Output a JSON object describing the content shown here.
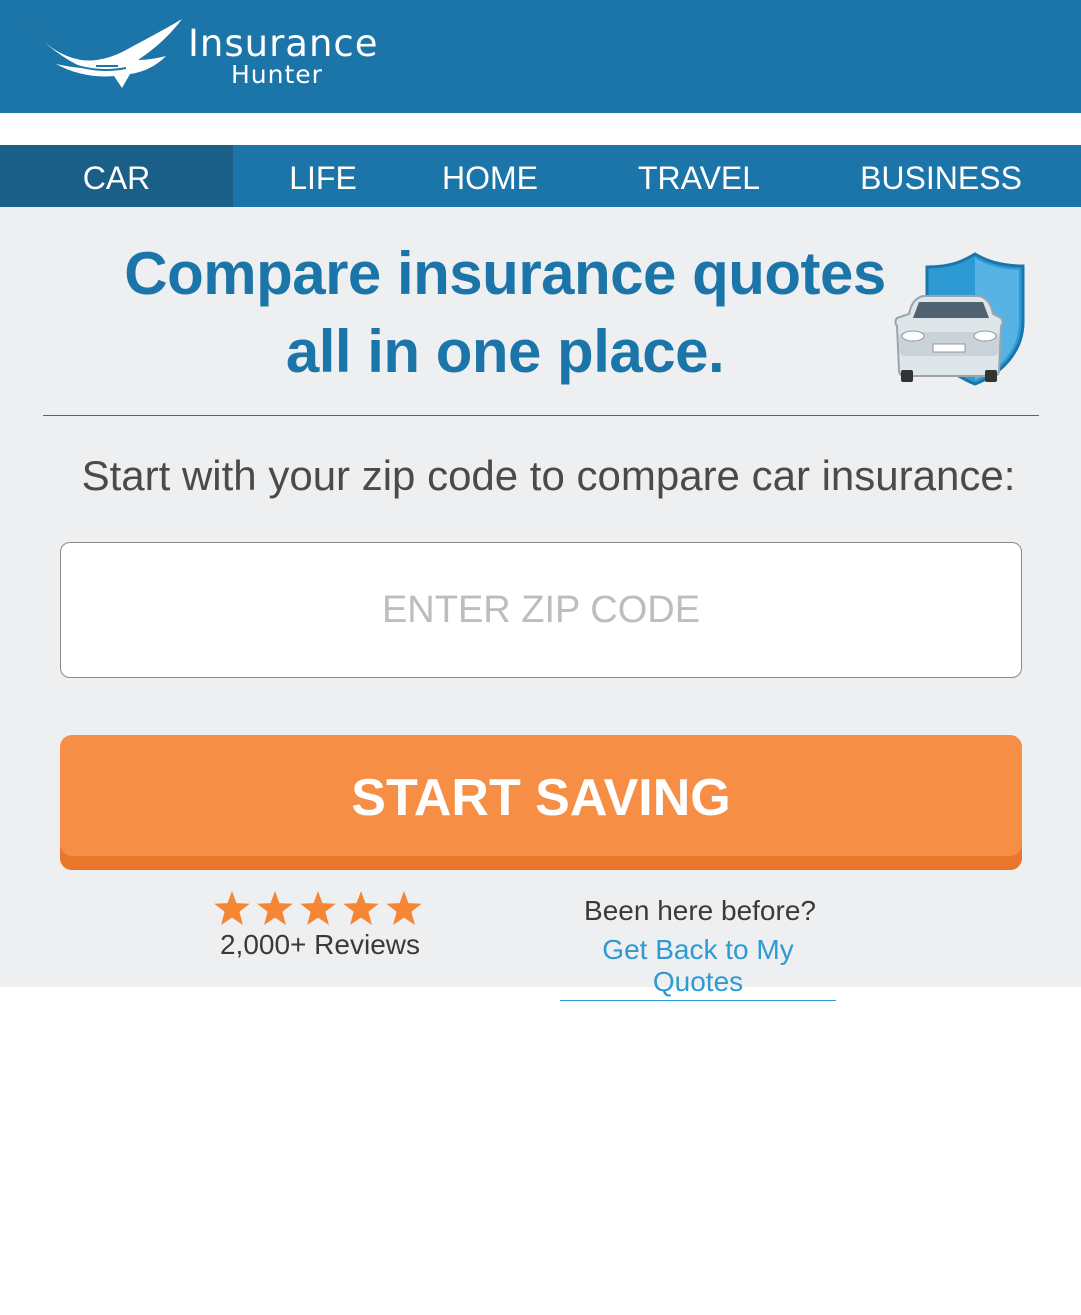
{
  "brand": {
    "name_line1": "Insurance",
    "name_line2": "Hunter",
    "logo_icon": "eagle-icon",
    "color": "#1c75a9"
  },
  "nav": {
    "items": [
      {
        "label": "CAR",
        "active": true
      },
      {
        "label": "LIFE",
        "active": false
      },
      {
        "label": "HOME",
        "active": false
      },
      {
        "label": "TRAVEL",
        "active": false
      },
      {
        "label": "BUSINESS",
        "active": false
      }
    ]
  },
  "hero": {
    "headline_line1": "Compare insurance quotes",
    "headline_line2": "all in one place.",
    "illustration": "car-shield-icon"
  },
  "form": {
    "prompt": "Start with your zip code to compare car insurance:",
    "zip_placeholder": "ENTER ZIP CODE",
    "zip_value": "",
    "submit_label": "START SAVING",
    "submit_color": "#f68e45"
  },
  "reviews": {
    "rating": 5,
    "max_rating": 5,
    "label": "2,000+ Reviews",
    "star_color": "#f58634"
  },
  "returning": {
    "question": "Been here before?",
    "link_label": "Get Back to My Quotes",
    "link_color": "#2e9ad3"
  }
}
